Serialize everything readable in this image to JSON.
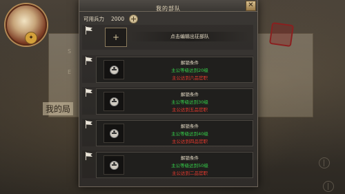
{
  "window": {
    "title": "我的部队",
    "close_label": "✕"
  },
  "header": {
    "troops_label": "可用兵力",
    "troops_value": "2000"
  },
  "add_slot": {
    "button_label": "+",
    "hint": "点击编辑出征部队"
  },
  "locked_slots": [
    {
      "title": "解锁条件",
      "cond_level": "主公等级达到20级",
      "cond_chapter": "主公达到六品官职"
    },
    {
      "title": "解锁条件",
      "cond_level": "主公等级达到30级",
      "cond_chapter": "主公达到五品官职"
    },
    {
      "title": "解锁条件",
      "cond_level": "主公等级达到40级",
      "cond_chapter": "主公达到四品官职"
    },
    {
      "title": "解锁条件",
      "cond_level": "主公等级达到50级",
      "cond_chapter": "主公达到二品官职"
    }
  ],
  "background": {
    "scene_text": "我的局",
    "small_text_1": "S",
    "small_text_2": "E"
  },
  "colors": {
    "condition_met": "#35d04a",
    "condition_unmet": "#e83a2e",
    "text_primary": "#e6dcc6"
  },
  "icons": {
    "close": "close-icon",
    "troops": "troop-coin-icon",
    "flag": "flag-icon",
    "lock": "lock-icon",
    "add": "add-icon"
  }
}
